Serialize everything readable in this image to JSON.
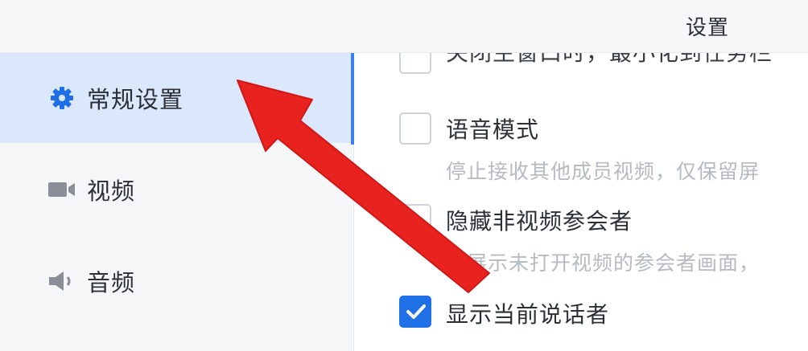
{
  "window": {
    "title": "设置"
  },
  "sidebar": {
    "items": [
      {
        "label": "常规设置",
        "icon": "gear-icon",
        "active": true
      },
      {
        "label": "视频",
        "icon": "video-camera-icon",
        "active": false
      },
      {
        "label": "音频",
        "icon": "speaker-icon",
        "active": false
      }
    ]
  },
  "main": {
    "cut_option": {
      "label": "关闭主窗口时，最小化到任务栏"
    },
    "options": [
      {
        "label": "语音模式",
        "description": "停止接收其他成员视频，仅保留屏",
        "checked": false
      },
      {
        "label": "隐藏非视频参会者",
        "description": "不展示未打开视频的参会者画面，",
        "checked": false
      },
      {
        "label": "显示当前说话者",
        "description": "",
        "checked": true
      }
    ]
  },
  "colors": {
    "accent": "#1f6fe6",
    "sidebar_active_bg": "#dbe8fb",
    "arrow": "#e8221f"
  }
}
